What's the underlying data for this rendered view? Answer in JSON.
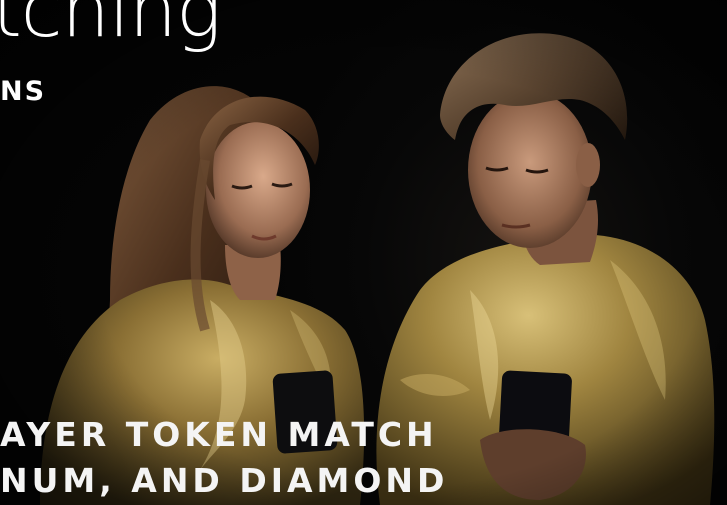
{
  "overlay": {
    "headline": "tching",
    "subhead": "NS",
    "caption_line1": "AYER TOKEN MATCH",
    "caption_line2": "NUM, AND DIAMOND"
  },
  "photo": {
    "subject": "two-people-looking-at-phones",
    "colors": {
      "background": "#050505",
      "jacket_gold": "#9c8140",
      "jacket_highlight": "#d9c27a",
      "skin": "#b88a6a",
      "hair_woman": "#5a3a22",
      "hair_man": "#4a3522",
      "text": "#ffffff"
    }
  }
}
